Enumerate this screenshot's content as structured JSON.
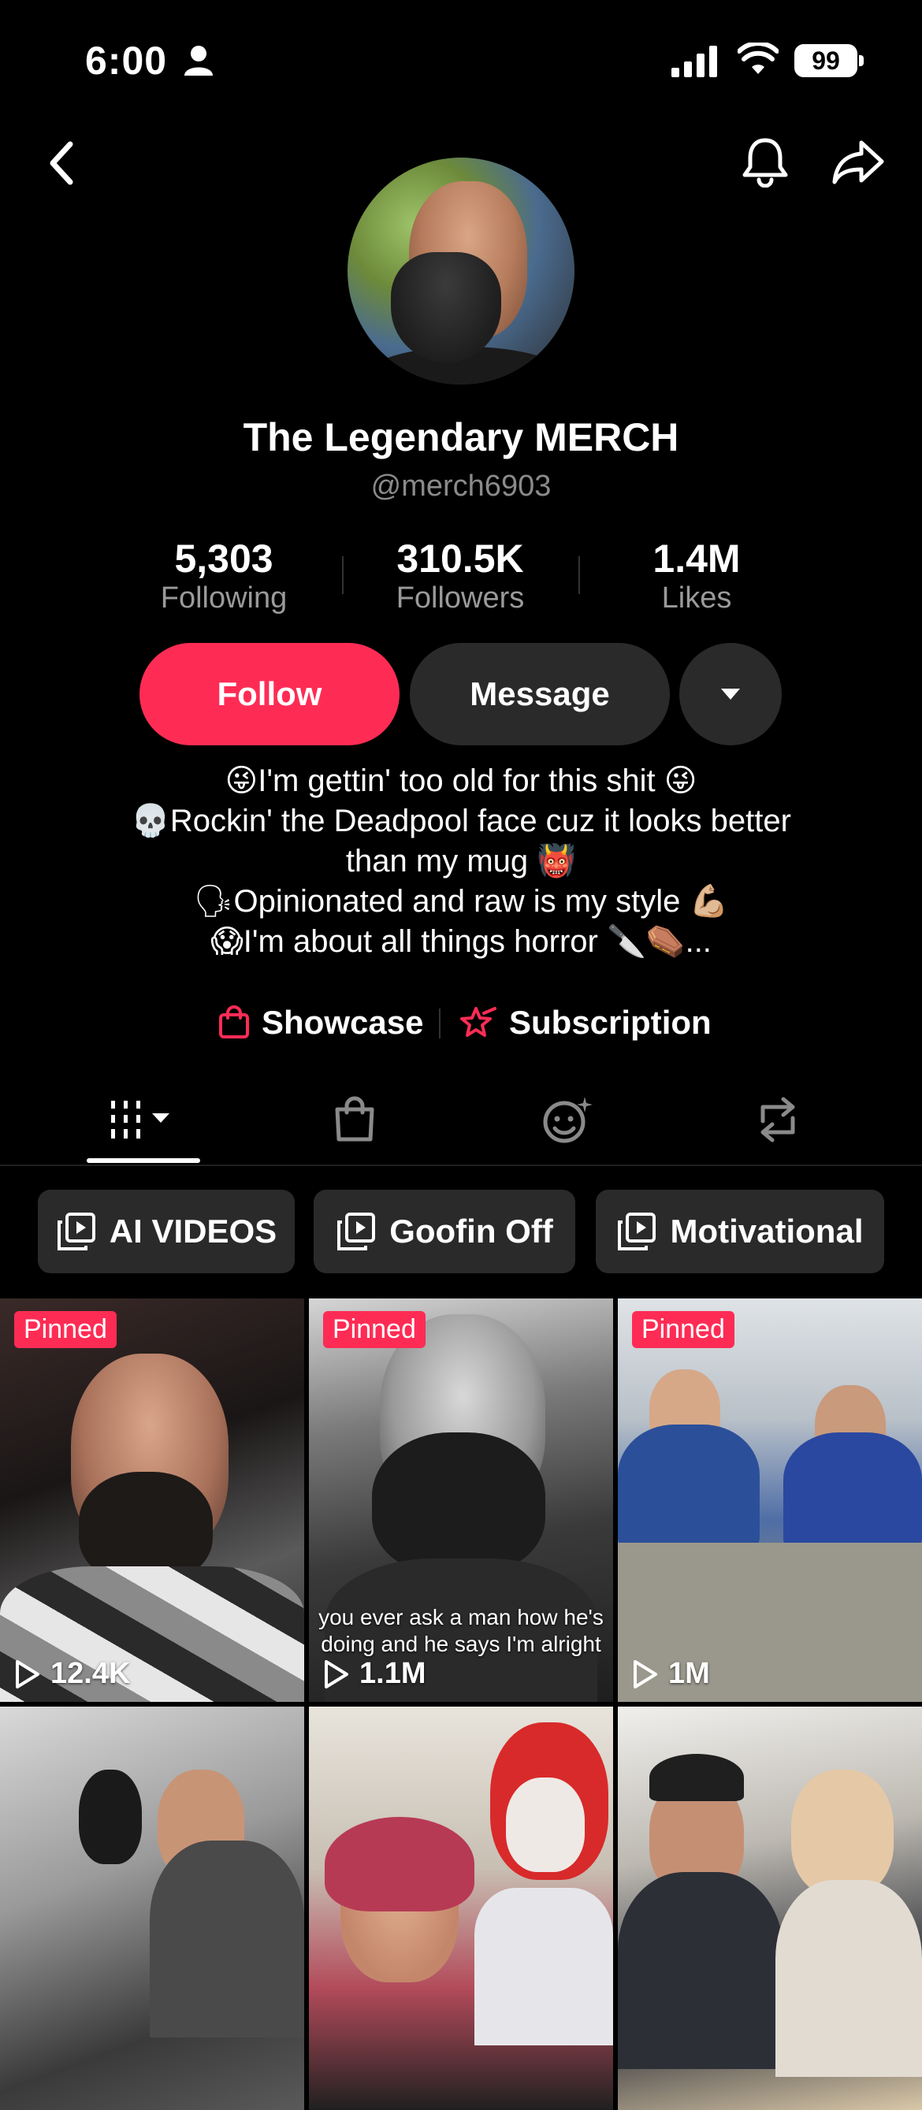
{
  "status_bar": {
    "time": "6:00",
    "battery": "99"
  },
  "profile": {
    "display_name": "The Legendary MERCH",
    "username": "@merch6903",
    "stats": [
      {
        "value": "5,303",
        "label": "Following"
      },
      {
        "value": "310.5K",
        "label": "Followers"
      },
      {
        "value": "1.4M",
        "label": "Likes"
      }
    ],
    "buttons": {
      "follow": "Follow",
      "message": "Message"
    },
    "bio": [
      "😜I'm gettin' too old for this shit 😜",
      "💀Rockin' the Deadpool face cuz it looks better",
      "than my mug 👹",
      "🗣Opinionated and raw is my style 💪🏼",
      "😱I'm about all things horror 🔪⚰️..."
    ],
    "links": {
      "showcase": "Showcase",
      "subscription": "Subscription"
    }
  },
  "tabs": [
    {
      "icon": "grid-icon",
      "selected": true
    },
    {
      "icon": "shopping-bag-icon",
      "selected": false
    },
    {
      "icon": "liked-icon",
      "selected": false
    },
    {
      "icon": "repost-icon",
      "selected": false
    }
  ],
  "playlists": [
    {
      "label": "AI VIDEOS"
    },
    {
      "label": "Goofin Off"
    },
    {
      "label": "Motivational"
    }
  ],
  "videos": [
    {
      "pinned": "Pinned",
      "views": "12.4K"
    },
    {
      "pinned": "Pinned",
      "views": "1.1M",
      "caption": "you ever ask a man how he's doing and he says I'm alright"
    },
    {
      "pinned": "Pinned",
      "views": "1M"
    },
    {},
    {},
    {}
  ],
  "colors": {
    "accent": "#fe2c55",
    "background": "#000000",
    "button_dark": "#2a2a2a",
    "muted_text": "#8a8a8a"
  }
}
